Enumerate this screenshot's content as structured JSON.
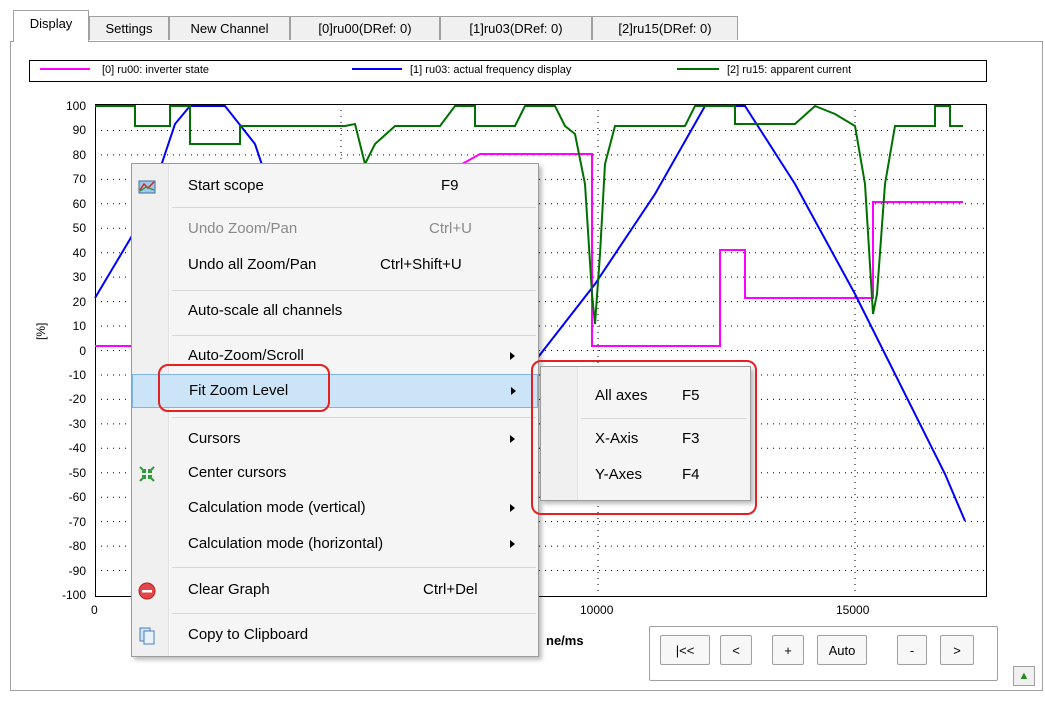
{
  "tabs": [
    {
      "label": "Display",
      "active": true
    },
    {
      "label": "Settings"
    },
    {
      "label": "New Channel"
    },
    {
      "label": "[0]ru00(DRef: 0)"
    },
    {
      "label": "[1]ru03(DRef: 0)"
    },
    {
      "label": "[2]ru15(DRef: 0)"
    }
  ],
  "legend": [
    {
      "label": "[0] ru00: inverter state",
      "color": "#ff00ff"
    },
    {
      "label": "[1] ru03: actual frequency display",
      "color": "#0000ff"
    },
    {
      "label": "[2] ru15: apparent current",
      "color": "#007000"
    }
  ],
  "plot": {
    "y_ticks": [
      "100",
      "90",
      "80",
      "70",
      "60",
      "50",
      "40",
      "30",
      "20",
      "10",
      "0",
      "-10",
      "-20",
      "-30",
      "-40",
      "-50",
      "-60",
      "-70",
      "-80",
      "-90",
      "-100"
    ],
    "y_label": "[%]",
    "x_ticks": [
      "0",
      "10000",
      "15000"
    ],
    "x_label_visible": "ne/ms"
  },
  "nav": {
    "first": "|<<",
    "prev": "<",
    "plus": "+",
    "auto": "Auto",
    "minus": "-",
    "next": ">"
  },
  "context_menu": {
    "items": [
      {
        "label": "Start scope",
        "shortcut": "F9",
        "icon": "scope-icon"
      },
      {
        "label": "Undo Zoom/Pan",
        "shortcut": "Ctrl+U",
        "disabled": true
      },
      {
        "label": "Undo all Zoom/Pan",
        "shortcut": "Ctrl+Shift+U"
      },
      {
        "label": "Auto-scale all channels"
      },
      {
        "label": "Auto-Zoom/Scroll",
        "submenu": true
      },
      {
        "label": "Fit Zoom Level",
        "submenu": true,
        "highlighted": true
      },
      {
        "label": "Cursors",
        "submenu": true
      },
      {
        "label": "Center cursors",
        "icon": "center-cursors-icon"
      },
      {
        "label": "Calculation mode (vertical)",
        "submenu": true
      },
      {
        "label": "Calculation mode (horizontal)",
        "submenu": true
      },
      {
        "label": "Clear Graph",
        "shortcut": "Ctrl+Del",
        "icon": "clear-icon"
      },
      {
        "label": "Copy to Clipboard",
        "icon": "clipboard-icon"
      }
    ]
  },
  "submenu": {
    "items": [
      {
        "label": "All axes",
        "shortcut": "F5"
      },
      {
        "label": "X-Axis",
        "shortcut": "F3"
      },
      {
        "label": "Y-Axes",
        "shortcut": "F4"
      }
    ]
  },
  "colors": {
    "magenta": "#ff00ff",
    "blue": "#0000ff",
    "green": "#007000",
    "highlight": "#cce4f7",
    "red_box": "#e52020"
  }
}
